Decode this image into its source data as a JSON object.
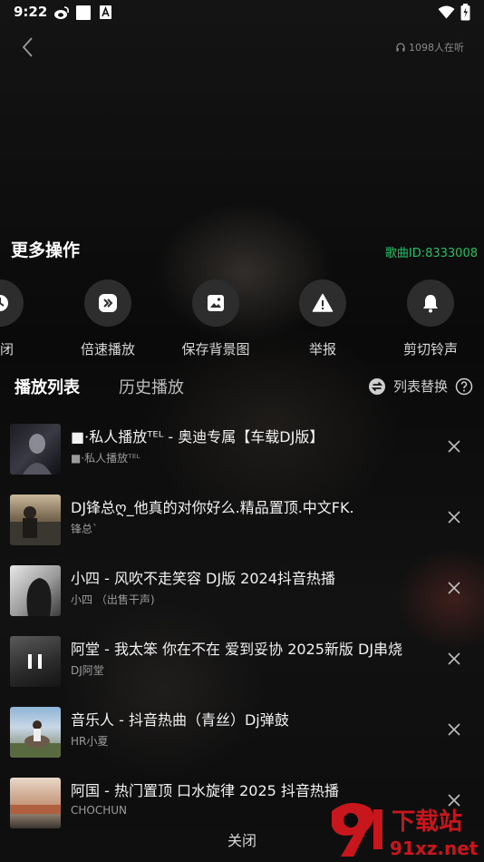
{
  "status_bar": {
    "time": "9:22"
  },
  "header": {
    "listeners": "1098人在听"
  },
  "sheet": {
    "title": "更多操作",
    "song_id": "歌曲ID:8333008"
  },
  "actions": [
    {
      "icon": "clock-icon",
      "label": "关闭"
    },
    {
      "icon": "speed-icon",
      "label": "倍速播放"
    },
    {
      "icon": "image-icon",
      "label": "保存背景图"
    },
    {
      "icon": "warning-icon",
      "label": "举报"
    },
    {
      "icon": "bell-icon",
      "label": "剪切铃声"
    }
  ],
  "tabs": {
    "playlist": "播放列表",
    "history": "历史播放"
  },
  "replace_label": "列表替换",
  "playlist": [
    {
      "title": "■·私人播放ᵀᴱᴸ - 奥迪专属【车载DJ版】",
      "artist": "■·私人播放ᵀᴱᴸ"
    },
    {
      "title": "DJ锋总ღ_他真的对你好么.精品置顶.中文FK.",
      "artist": "锋总`"
    },
    {
      "title": "小四 - 风吹不走笑容 DJ版 2024抖音热播",
      "artist": "小四 （出售干声)"
    },
    {
      "title": "阿堂 - 我太笨 你在不在 爱到妥协 2025新版 DJ串烧",
      "artist": "DJ阿堂"
    },
    {
      "title": "音乐人 - 抖音热曲（青丝）Dj弹鼓",
      "artist": "HR小夏"
    },
    {
      "title": "阿国 - 热门置顶 口水旋律 2025 抖音热播",
      "artist": "CHOCHUN"
    }
  ],
  "close_label": "关闭",
  "watermark": {
    "text_top": "下载站",
    "text_bottom": "91xz.net"
  },
  "colors": {
    "accent_green": "#21c06a",
    "bg": "#0c0c0c",
    "button_bg": "#2d2d2d"
  }
}
